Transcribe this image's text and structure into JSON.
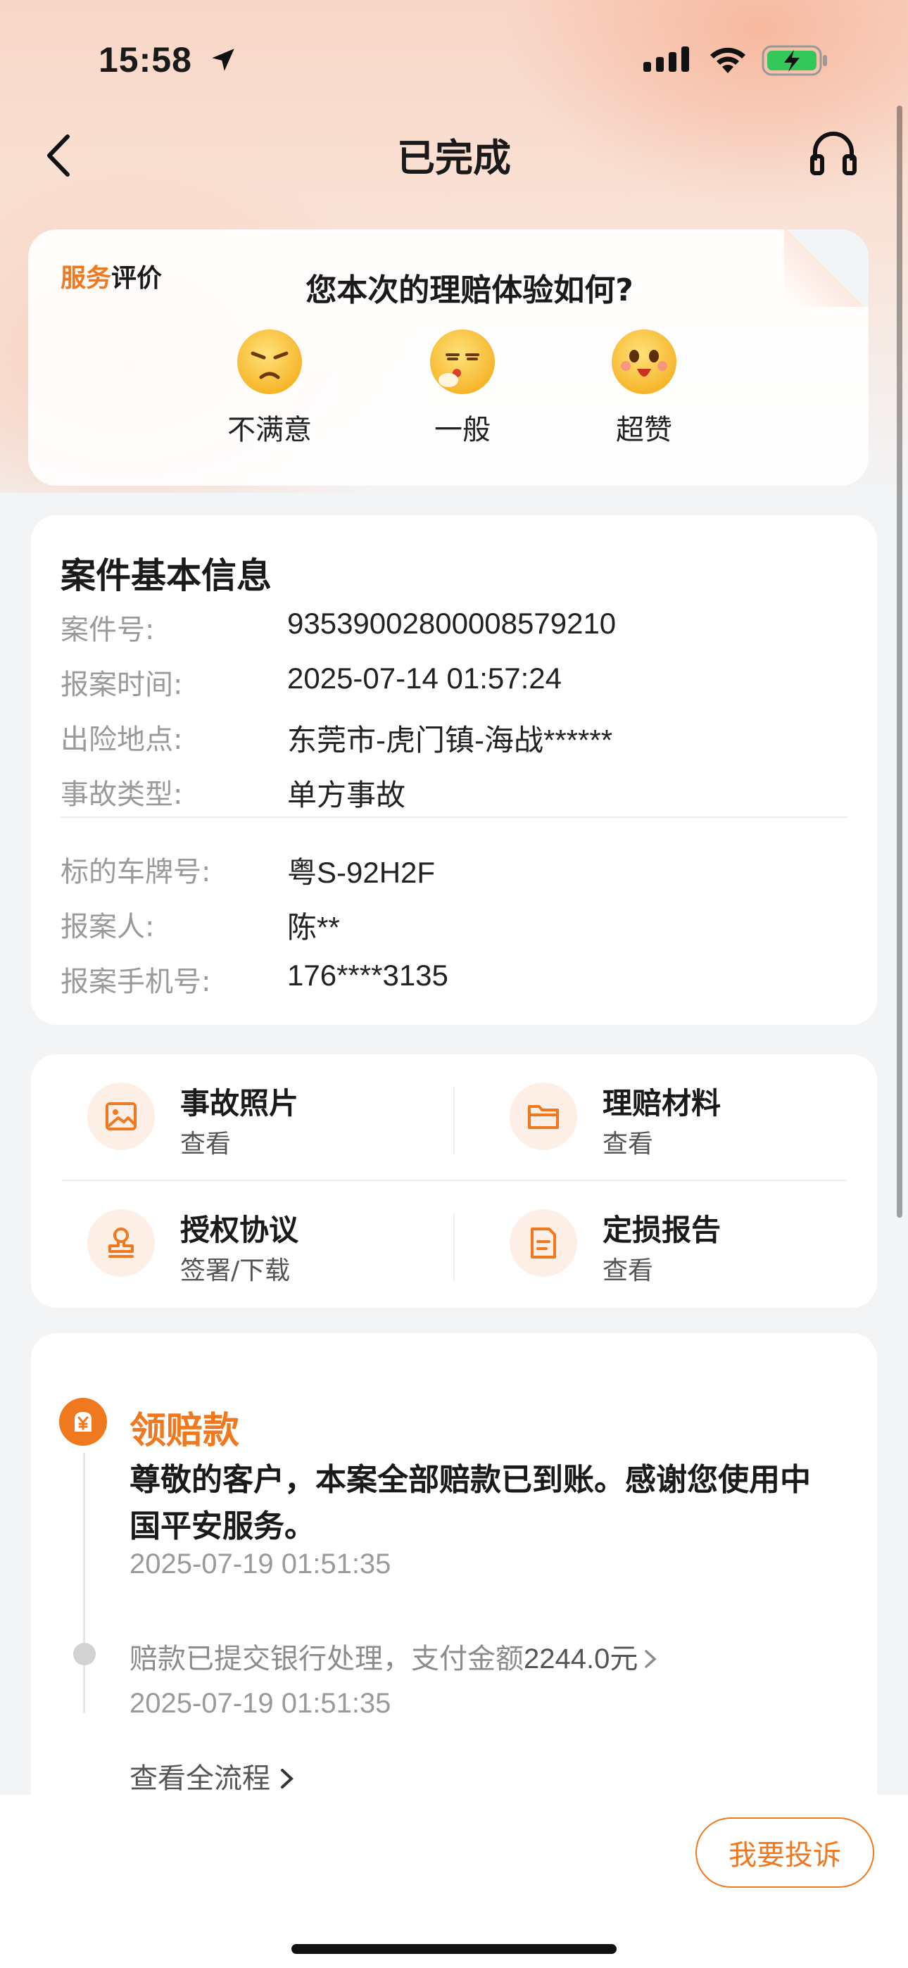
{
  "status_bar": {
    "time": "15:58"
  },
  "nav": {
    "title": "已完成"
  },
  "rating": {
    "tag_highlight": "服务",
    "tag_rest": "评价",
    "question": "您本次的理赔体验如何?",
    "options": [
      {
        "label": "不满意",
        "icon": "angry-face-icon"
      },
      {
        "label": "一般",
        "icon": "neutral-face-icon"
      },
      {
        "label": "超赞",
        "icon": "happy-face-icon"
      }
    ]
  },
  "case_info": {
    "title": "案件基本信息",
    "rows": [
      {
        "key": "案件号:",
        "value": "93539002800008579210"
      },
      {
        "key": "报案时间:",
        "value": "2025-07-14 01:57:24"
      },
      {
        "key": "出险地点:",
        "value": "东莞市-虎门镇-海战******"
      },
      {
        "key": "事故类型:",
        "value": "单方事故"
      },
      {
        "key": "标的车牌号:",
        "value": "粤S-92H2F"
      },
      {
        "key": "报案人:",
        "value": "陈**"
      },
      {
        "key": "报案手机号:",
        "value": "176****3135"
      }
    ]
  },
  "quick_actions": [
    {
      "title": "事故照片",
      "sub": "查看",
      "icon": "photo-icon"
    },
    {
      "title": "理赔材料",
      "sub": "查看",
      "icon": "folder-icon"
    },
    {
      "title": "授权协议",
      "sub": "签署/下载",
      "icon": "stamp-icon"
    },
    {
      "title": "定损报告",
      "sub": "查看",
      "icon": "report-icon"
    }
  ],
  "timeline": {
    "title": "领赔款",
    "message": "尊敬的客户，本案全部赔款已到账。感谢您使用中国平安服务。",
    "date1": "2025-07-19 01:51:35",
    "sub_text": "赔款已提交银行处理，支付金额",
    "amount": "2244.0元",
    "date2": "2025-07-19 01:51:35",
    "more": "查看全流程"
  },
  "bottom": {
    "complain": "我要投诉"
  },
  "colors": {
    "accent": "#f0781e",
    "muted": "#9a9a9a"
  }
}
